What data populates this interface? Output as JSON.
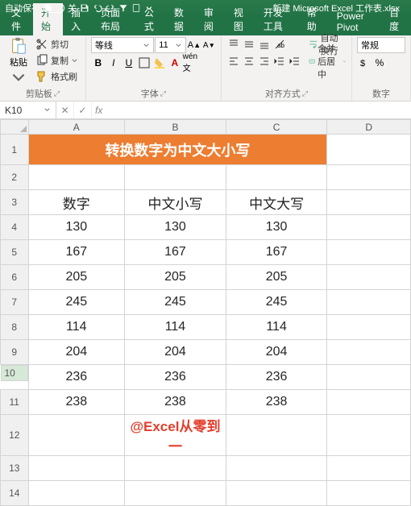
{
  "titlebar": {
    "autosave": "自动保存",
    "off": "关",
    "filename": "新建 Microsoft Excel 工作表.xlsx"
  },
  "tabs": {
    "file": "文件",
    "home": "开始",
    "insert": "插入",
    "layout": "页面布局",
    "formulas": "公式",
    "data": "数据",
    "review": "审阅",
    "view": "视图",
    "dev": "开发工具",
    "help": "帮助",
    "pp": "Power Pivot",
    "baidu": "百度"
  },
  "ribbon": {
    "paste": "粘贴",
    "cut": "剪切",
    "copy": "复制",
    "format_painter": "格式刷",
    "clipboard": "剪贴板",
    "font_name": "等线",
    "font_size": "11",
    "font_group": "字体",
    "align_group": "对齐方式",
    "wrap": "自动换行",
    "merge": "合并后居中",
    "num_format": "常规",
    "num_group": "数字"
  },
  "namebox": "K10",
  "cols": [
    "A",
    "B",
    "C",
    "D"
  ],
  "rows": [
    "1",
    "2",
    "3",
    "4",
    "5",
    "6",
    "7",
    "8",
    "9",
    "10",
    "11",
    "12",
    "13",
    "14"
  ],
  "cells": {
    "title": "转换数字为中文大小写",
    "h1": "数字",
    "h2": "中文小写",
    "h3": "中文大写",
    "data": [
      [
        "130",
        "130",
        "130"
      ],
      [
        "167",
        "167",
        "167"
      ],
      [
        "205",
        "205",
        "205"
      ],
      [
        "245",
        "245",
        "245"
      ],
      [
        "114",
        "114",
        "114"
      ],
      [
        "204",
        "204",
        "204"
      ],
      [
        "236",
        "236",
        "236"
      ],
      [
        "238",
        "238",
        "238"
      ]
    ],
    "footer": "@Excel从零到一"
  }
}
